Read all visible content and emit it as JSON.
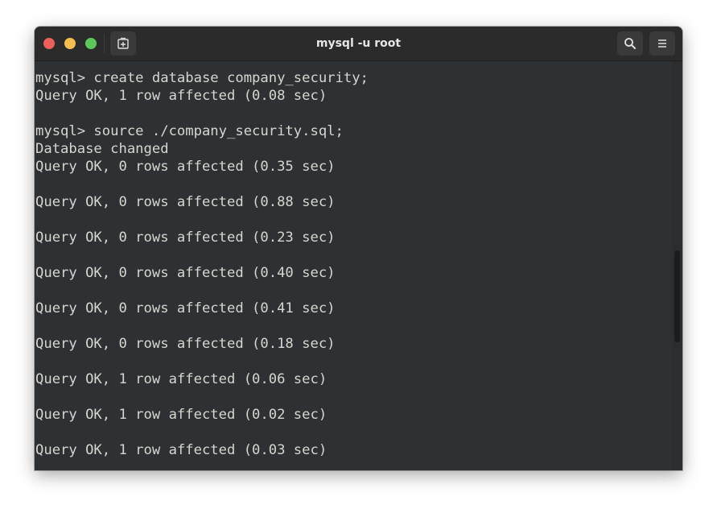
{
  "window": {
    "title": "mysql -u root"
  },
  "toolbar": {
    "new_tab_icon": "new-tab-icon",
    "search_icon": "search-icon",
    "menu_icon": "hamburger-menu-icon"
  },
  "colors": {
    "close": "#ec5f5a",
    "minimize": "#f6be4f",
    "maximize": "#5cc85a",
    "terminal_bg": "#2e3133",
    "terminal_fg": "#d3d7cf"
  },
  "terminal": {
    "lines": [
      "mysql> create database company_security;",
      "Query OK, 1 row affected (0.08 sec)",
      "",
      "mysql> source ./company_security.sql;",
      "Database changed",
      "Query OK, 0 rows affected (0.35 sec)",
      "",
      "Query OK, 0 rows affected (0.88 sec)",
      "",
      "Query OK, 0 rows affected (0.23 sec)",
      "",
      "Query OK, 0 rows affected (0.40 sec)",
      "",
      "Query OK, 0 rows affected (0.41 sec)",
      "",
      "Query OK, 0 rows affected (0.18 sec)",
      "",
      "Query OK, 1 row affected (0.06 sec)",
      "",
      "Query OK, 1 row affected (0.02 sec)",
      "",
      "Query OK, 1 row affected (0.03 sec)"
    ]
  }
}
